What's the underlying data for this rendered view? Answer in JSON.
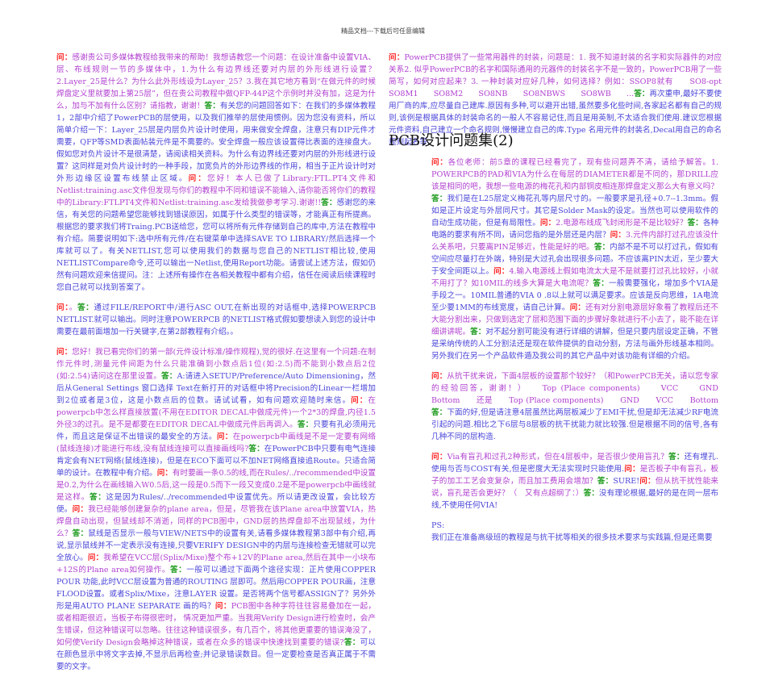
{
  "header": "精品文档---下载后可任意编辑",
  "section_title": "PCB设计问题集(2)",
  "colors": {
    "question_label": "#ff2222",
    "answer_label": "#1a9a1a",
    "question_text": "#b040d0",
    "answer_text": "#4a44d8"
  },
  "left": {
    "paragraphs": [
      [
        {
          "role": "question",
          "label": "问：",
          "text": "感谢贵公司多媒体教程给我带来的帮助！我想请教您一个问题：在设计准备中设置VIA、层、布线规则一节的多媒体中，1.为什么有边界线还要对内层的外形线进行设置？2.Layer_25是什么？为什么此外形线设为Layer_25？3.我在其它地方看到“在做元件的时候焊盘定义里就要加上第25层”，但在贵公司教程中做QFP-44P这个示例时并没有加，这是为什么，加与不加有什么区别？请指教，谢谢！"
        },
        {
          "role": "answer",
          "label": "答：",
          "text": "有关您的问题回答如下：在我们的多媒体教程1，2部中介绍了PowerPCB的层使用，以及我们推举的层使用惯例。因为您没有资料，所以简单介绍一下：Layer_25层是内层负片设计时使用，用来做安全焊盘，注意只有DIP元件才需要，QFP等SMD表面帖装元件是不需要的。安全焊盘一般应该设置得比表面的连接盘大。假如您对负片设计不是很清楚，请阅读相关资料。为什么有边界线还要对内层的外形线进行设置？这同样是对负片设计时的一种手段，加宽负片的外形边界线的作用，相当于正片设计时对外形边缘区设置布线禁止区域。"
        },
        {
          "role": "question",
          "label": "问：",
          "text": "您好！本人已做了Library:FTL.PT4文件和Netlist:training.asc文件但发现与你们的教程中不同和错误不能输入,请你能否将你们的教程中的Library:FTLPT4文件和Netlist:training.asc发给我做参考学习.谢谢!!"
        },
        {
          "role": "answer",
          "label": "答：",
          "text": "感谢您的来信，有关您的问题希望您能够找到错误原因，如属于什么类型的错误等，才能真正有所提高。根据您的要求我们将Traing.PCB送给您，您可以将所有元件存储到自己的库中,方法在教程中有介绍。简要说明如下:选中所有元件/在右键菜单中选择SAVE TO LIBRARY/然后选择一个库就可以了。有关NETLIST,您可以使用我们的数据与您自己的NETLIST相比较,使用NETLISTCompare命令,还可以输出一Netlist,使用Report功能。请尝试上述方法，假如仍然有问题欢迎来信提问。注：上述所有操作在各相关教程中都有介绍，信任在阅读后续课程时您自己就可以找到答案了。"
        }
      ],
      [
        {
          "role": "question",
          "label": "问：",
          "text": "。"
        },
        {
          "role": "answer",
          "label": "答：",
          "text": "通过FILE/REPORT中/进行ASC OUT,在新出现的对话框中,选择POWERPCB NETLIST.就可以输出。同时注意POWERPCB 的NETLIST格式假如要想读入到您的设计中需要在最前面增加一行关键字,在第2部教程有介绍。。"
        }
      ],
      [
        {
          "role": "question",
          "label": "问：",
          "text": "您好！我已看完你们的第一部(元件设计标准/操作规程),觉的很好.在这里有一个问题:在制作元件时,测量元件间距为什么只能准确到小数点后1位(如:2.5)而不能到小数点后2位(如:2.54)请问这在那里设置。"
        },
        {
          "role": "answer",
          "label": "答：",
          "text": "A:请进入SETUP/Preference/Auto Dimensioning，然后从General Settings 窗口选择 Text在新打开的对话框中将Precision的Linear一栏增加到2位或者是3位，这是小数点后的位数。请试试看，如有问题欢迎随时来信。"
        },
        {
          "role": "question",
          "label": "问：",
          "text": "在powerpcb中怎么样直接放置(不用在EDITOR DECAL中做成元件)一个2*3的焊盘,内径1.5外径3的过孔。是不是都要在EDITOR DECAL中做成元件后再调入。"
        },
        {
          "role": "answer",
          "label": "答：",
          "text": "只要有孔必须用元件，而且这是保证不出错误的最安全的方法。"
        },
        {
          "role": "question",
          "label": "问：",
          "text": "在powerpcb中画线是不是一定要有网络(鼠线连接)才能进行布线,没有鼠线连接可以直接画线吗?"
        },
        {
          "role": "answer",
          "label": "答：",
          "text": "在PowerPCB中只要有电气连接肯定会有NET网络(鼠线连接)，但是在ECO下面可以不加NET网络直接追Route。只适合简单的设计。在教程中有介绍。"
        },
        {
          "role": "question",
          "label": "问：",
          "text": "有时要画一条0.5的线,而在Rules/../recommended中设置是0.2,为什么在画线输入W0.5后,这一段是0.5而下一段又变成0.2是不是powerpcb中画线就是这样。"
        },
        {
          "role": "answer",
          "label": "答：",
          "text": "这是因为Rules/../recommended中设置优先。所以请更改设置，会比较方便。"
        },
        {
          "role": "question",
          "label": "问：",
          "text": "我已经能够创建复杂的plane area，但是，尽管我在该Plane area中放置VIA，热焊盘自动出现，但鼠线却不消逝，同样的PCB图中，GND层的热焊盘却不出现鼠线，为什么？"
        },
        {
          "role": "answer",
          "label": "答：",
          "text": "鼠线是否显示一般与VIEW/NETS中的设置有关,请看多媒体教程第3部中有介绍,再说,显示鼠线并不一定表示没有连接,只要VERIFY DESIGN中的内层与连接检查无错就可以完全放心。"
        },
        {
          "role": "question",
          "label": "问：",
          "text": "我希望在VCC层(Splix/Mixe)整个布+12V的Plane area,然后在其中一小块布+12S的Plane area如何操作。"
        },
        {
          "role": "answer",
          "label": "答：",
          "text": "一般可以通过下面两个途径实现：正片使用COPPER POUR 功能,此时VCC层设置为普通的ROUTING 层即可。然后用COPPER POUR画，注意FLOOD设置。或者Splix/Mixe，注意LAYER 设置。是否将两个信号都ASSIGN了？另外外形是用AUTO PLANE SEPARATE 画的吗？"
        },
        {
          "role": "question",
          "label": "问：",
          "text": "PCB图中各种字符往往容易叠加在一起，或者相距很近，当板子布得很密时， 情况更加严重。当我用Verify Design进行检查时，会产生错误，但这种错误可以忽略。往往这种错误很多，有几百个，将其他更重要的错误淹没了，如何使Verify Design会略掉这种错误，或者在众多的错误中快速找到重要的错误?"
        },
        {
          "role": "answer",
          "label": "答：",
          "text": "可以在颜色显示中将文字去掉,不显示后再检查;并记录错误数目。但一定要检查是否真正属于不需要的文字。"
        }
      ]
    ]
  },
  "right_top": {
    "paragraphs": [
      [
        {
          "role": "question",
          "label": "问：",
          "text": "PowerPCB提供了一些常用器件的封装，问题是：1. 我不知道封装的名字和实际器件的对应关系2. 似乎PowerPCB的名字和国际通用的元器件的封装名字不是一致的，PowerPCB用了一些简写，如何对应起来？3. 一种封装对应好几种，如何选择？例如：SSOP8就有　　SO8-opt　　SO8M1　　SO8M2　　SO8NB　　SO8NBWS　　SO8WB　　..."
        },
        {
          "role": "answer",
          "label": "答：",
          "text": "再次重申,最好不要使用厂商的库,应尽量自己建库.原因有多种,可以避开出错,虽然要多化些时间,各家起名都有自己的规则,该例是根据具体的封装命名的一般人不容易记住,而且是用英制,不太适合我们使用.建议您根据元件资料,自己建立一个命名规则,慢慢建立自己的库.Type 名用元件的封装名,Decal用自己的命名规则起名等."
        }
      ]
    ]
  },
  "right_body": {
    "paragraphs": [
      [
        {
          "role": "question",
          "label": "问：",
          "text": "各位老师：前5章的课程已经看完了，现有些问题弄不清，请给予解答。1. POWERPCB的PAD和VIA为什么在每层的DIAMETER都是不同的，那DRILL应该是相同的吧，我想一些电源的梅花孔和内部铜皮相连那焊盘定义那么大有意义吗？"
        },
        {
          "role": "answer",
          "label": "答：",
          "text": "我们是在L25层定义梅花孔等内层尺寸的。一般要求是孔径+0.7--1.3mm。假如是正片设定与外层同尺寸。其它是Solder Mask的设定。当然也可以使用软件的自动生成功能，但是有局限性。"
        },
        {
          "role": "question",
          "label": "问：",
          "text": "2.电源布线成飞封闭形是不是比较好？"
        },
        {
          "role": "answer",
          "label": "答：",
          "text": "各种电路的要求有所不同，请问您指的是外层还是内层？"
        },
        {
          "role": "question",
          "label": "问：",
          "text": "3.元件内部打过孔应该没什么关系吧，只要离PIN足够近，性能是好的吧。"
        },
        {
          "role": "answer",
          "label": "答：",
          "text": "内部不是不可以打过孔，假如有空间应尽量打在外端，特别是大过孔会出现很多问题。不应该离PIN太近，至少要大于安全间距以上。"
        },
        {
          "role": "question",
          "label": "问：",
          "text": "4.输入电源线上假如电流太大是不是就要打过孔比较好，小就不用打了？如10MIL的线多大算是大电流呢？"
        },
        {
          "role": "answer",
          "label": "答：",
          "text": "一般需要强化，增加多个VIA是手段之一。10MIL普通的VIA 0 .8以上就可以满足要求。应该是反向思维，1A电流至少要1MM的布线宽度，请自己计算。"
        },
        {
          "role": "question",
          "label": "问：",
          "text": "还有对分割电源层好象看了教程后还不大能分割出来，只做到选定了层和范围下面的步骤好象就进行不小去了，能不能在详细讲讲呢。"
        },
        {
          "role": "answer",
          "label": "答：",
          "text": "对不起分割可能没有进行详细的讲解，但是只要内层设定正确，不管是采纳传统的人工分割法还是现在软件提供的自动分割，方法与画外形线基本相同。另外我们在另一个产品软件遁及我公司的其它产品中对该功能有详细的介绍。"
        }
      ],
      [
        {
          "role": "question",
          "label": "问：",
          "text": "从抗干扰来说，下面4层板的设置那个较好？（和PowerPCB无关，请以您专家的经验回答，谢谢！）　　Top (Place components)　　VCC　　GND　　Bottom　　还是　　Top (Place components)　　GND　　VCC　　Bottom"
        },
        {
          "role": "answer",
          "label": "答：",
          "text": "下面的好,但是请注意4层虽然比两层板减少了EMI干扰,但是却无法减少RF电流引起的问题.相比之下6层与8层板的抗干扰能力就比较强.但是根据不同的信号,各有几种不同的层构造."
        }
      ],
      [
        {
          "role": "question",
          "label": "问：",
          "text": "Via有盲孔和过孔2种形式，但在4层板中，是否很少使用盲孔？"
        },
        {
          "role": "answer",
          "label": "答：",
          "text": "还有埋孔.使用与否与COST有关,但是密度大无法实现时只能使用."
        },
        {
          "role": "question",
          "label": "问：",
          "text": "是否板子中有盲孔，板子的加工工艺会变复杂，而且加工费用会增加？"
        },
        {
          "role": "answer",
          "label": "答：",
          "text": "SURE!"
        },
        {
          "role": "question",
          "label": "问：",
          "text": "但从抗干扰性能来说，盲孔是否会更好？（　又有点超纲了：）"
        },
        {
          "role": "answer",
          "label": "答：",
          "text": "没有理论根据,最好的是在同一层布线,不使用任何VIA!"
        }
      ]
    ],
    "ps_label": "PS:",
    "ps_text": "我们正在准备高级班的教程是与抗干扰等相关的很多技术要求与实践篇,但是还需要"
  }
}
